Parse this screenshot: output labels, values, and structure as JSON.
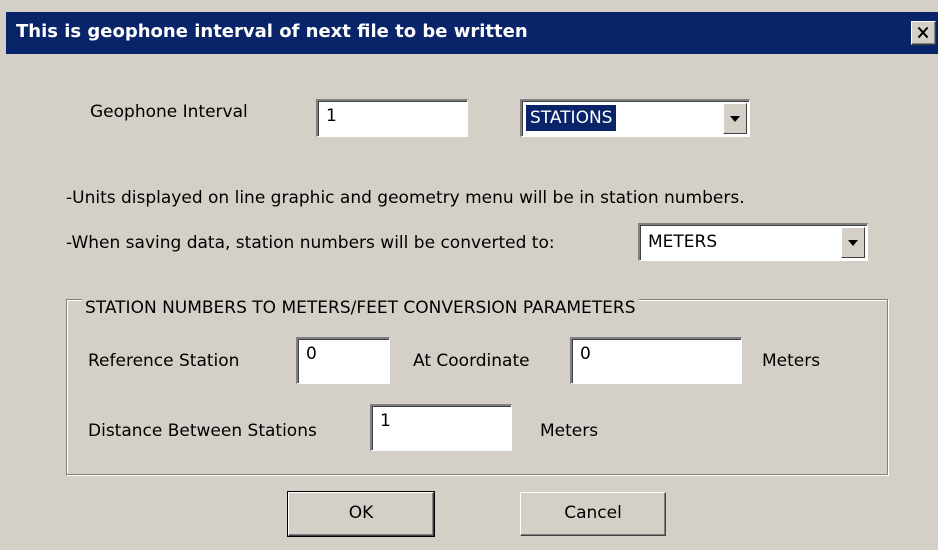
{
  "window": {
    "title": "This is geophone interval of next file to be written"
  },
  "geophone": {
    "label": "Geophone Interval",
    "value": "1",
    "unit_selected": "STATIONS"
  },
  "info": {
    "line1": "-Units displayed on line graphic and geometry menu will be in station numbers.",
    "line2": "-When saving data, station numbers will be converted to:",
    "convert_unit": "METERS"
  },
  "conversion": {
    "group_title": "STATION NUMBERS TO METERS/FEET CONVERSION PARAMETERS",
    "reference_station_label": "Reference Station",
    "reference_station_value": "0",
    "at_coordinate_label": "At Coordinate",
    "at_coordinate_value": "0",
    "coordinate_unit": "Meters",
    "distance_label": "Distance Between Stations",
    "distance_value": "1",
    "distance_unit": "Meters"
  },
  "buttons": {
    "ok": "OK",
    "cancel": "Cancel"
  },
  "icons": {
    "close": "close-icon",
    "dropdown": "chevron-down-icon"
  }
}
